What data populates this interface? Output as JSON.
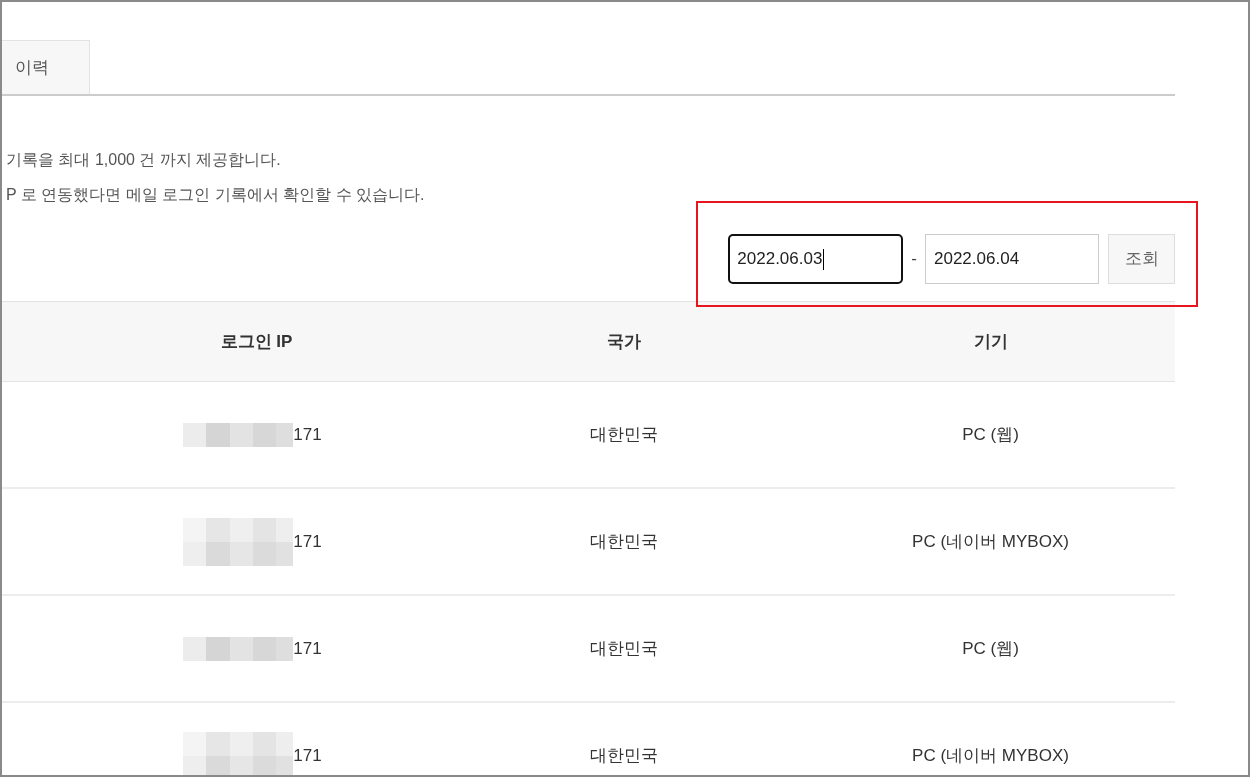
{
  "tabs": [
    {
      "label": "이력",
      "selected": false
    }
  ],
  "notices": [
    "기록을 최대 1,000 건 까지 제공합니다.",
    "P 로 연동했다면 메일 로그인 기록에서 확인할 수 있습니다."
  ],
  "date_filter": {
    "highlighted": true,
    "start": {
      "value": "2022.06.03",
      "focused": true
    },
    "separator": "-",
    "end": {
      "value": "2022.06.04",
      "focused": false
    },
    "button": "조회"
  },
  "table": {
    "columns": [
      "로그인 IP",
      "국가",
      "기기"
    ],
    "rows": [
      {
        "login_ip": {
          "text": "171",
          "masked": true,
          "tall_mask": false
        },
        "country": "대한민국",
        "device": "PC (웹)"
      },
      {
        "login_ip": {
          "text": "171",
          "masked": true,
          "tall_mask": true
        },
        "country": "대한민국",
        "device": "PC (네이버 MYBOX)"
      },
      {
        "login_ip": {
          "text": "171",
          "masked": true,
          "tall_mask": false
        },
        "country": "대한민국",
        "device": "PC (웹)"
      },
      {
        "login_ip": {
          "text": "171",
          "masked": true,
          "tall_mask": true
        },
        "country": "대한민국",
        "device": "PC (네이버 MYBOX)"
      }
    ]
  }
}
